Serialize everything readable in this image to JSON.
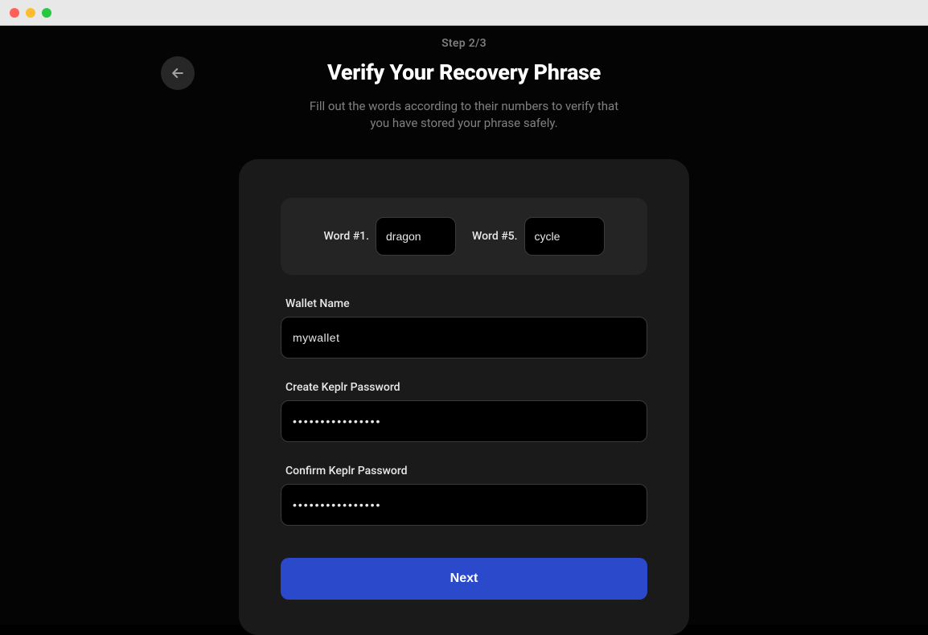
{
  "header": {
    "step_label": "Step 2/3",
    "title": "Verify Your Recovery Phrase",
    "subtitle": "Fill out the words according to their numbers to verify that you have stored your phrase safely."
  },
  "verify": {
    "words": [
      {
        "label": "Word #1.",
        "value": "dragon"
      },
      {
        "label": "Word #5.",
        "value": "cycle"
      }
    ]
  },
  "form": {
    "wallet_name": {
      "label": "Wallet Name",
      "value": "mywallet"
    },
    "create_password": {
      "label": "Create Keplr Password",
      "value": "••••••••••••••••"
    },
    "confirm_password": {
      "label": "Confirm Keplr Password",
      "value": "••••••••••••••••"
    }
  },
  "buttons": {
    "next": "Next"
  }
}
